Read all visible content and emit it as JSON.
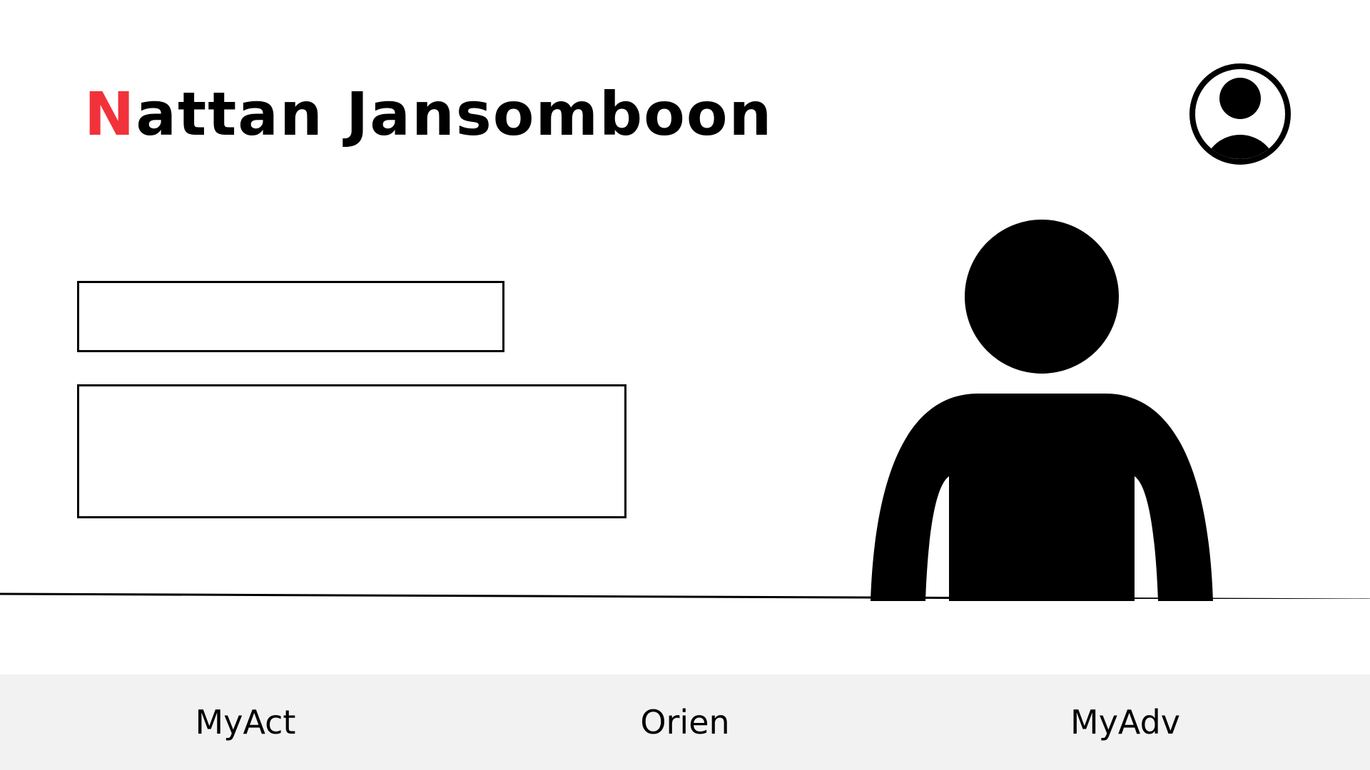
{
  "header": {
    "title_initial": "N",
    "title_rest": "attan Jansomboon",
    "profile_icon": "account-circle-icon"
  },
  "main": {
    "illustration_icon": "person-icon"
  },
  "bottom_nav": {
    "items": [
      {
        "label": "MyAct"
      },
      {
        "label": "Orien"
      },
      {
        "label": "MyAdv"
      }
    ]
  },
  "colors": {
    "accent": "#f2323a",
    "text": "#000000",
    "background": "#ffffff",
    "nav_background": "#f2f2f2"
  }
}
